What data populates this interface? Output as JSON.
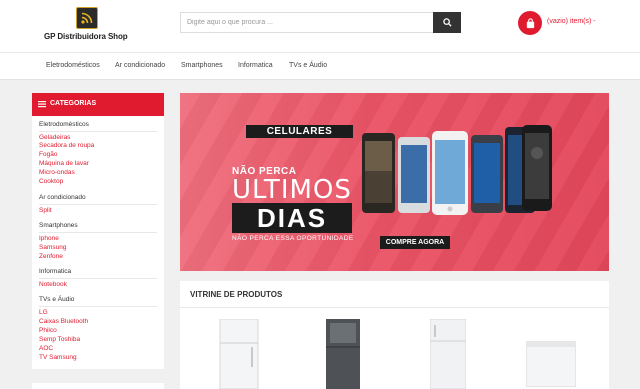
{
  "header": {
    "logo_text": "GP Distribuidora Shop",
    "search_placeholder": "Digite aqui o que procura ...",
    "cart_label": "(vazio) item(s) -"
  },
  "nav": {
    "items": [
      "Eletrodomésticos",
      "Ar condicionado",
      "Smartphones",
      "Informatica",
      "TVs e Áudio"
    ]
  },
  "sidebar": {
    "title": "CATEGORIAS",
    "groups": [
      {
        "name": "Eletrodomésticos",
        "items": [
          "Geladeiras",
          "Secadora de roupa",
          "Fogão",
          "Máquina de lavar",
          "Micro-ondas",
          "Cooktop"
        ]
      },
      {
        "name": "Ar condicionado",
        "items": [
          "Split"
        ]
      },
      {
        "name": "Smartphones",
        "items": [
          "Iphone",
          "Samsung",
          "Zenfone"
        ]
      },
      {
        "name": "Informatica",
        "items": [
          "Notebook"
        ]
      },
      {
        "name": "TVs e Áudio",
        "items": [
          "LG",
          "Caixas Bluetooth",
          "Philco",
          "Semp Toshiba",
          "AOC",
          "TV Samsung"
        ]
      }
    ]
  },
  "banner": {
    "tag": "CELULARES",
    "headline_small": "NÃO PERCA",
    "headline_big": "ULTIMOS",
    "headline_box": "DIAS",
    "subline": "NÃO PERCA ESSA OPORTUNIDADE",
    "cta": "COMPRE AGORA"
  },
  "vitrine": {
    "title": "VITRINE DE PRODUTOS"
  },
  "colors": {
    "accent": "#e11b2f",
    "dark": "#333333",
    "banner": "#ea5466"
  }
}
